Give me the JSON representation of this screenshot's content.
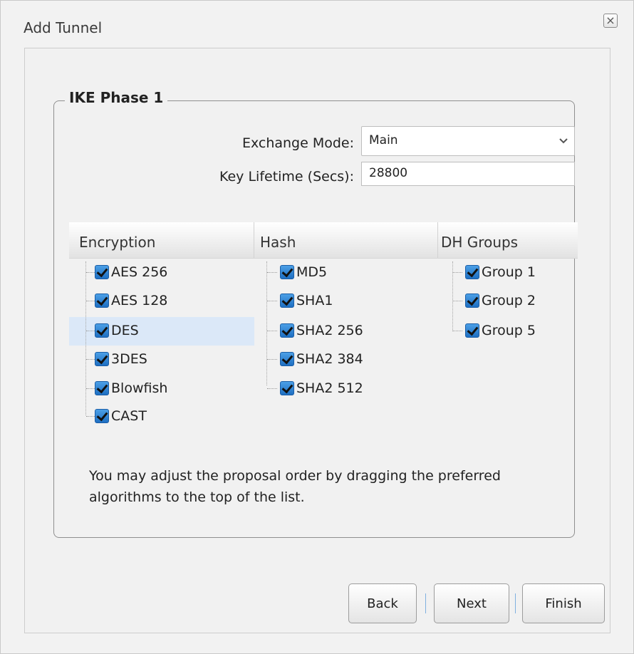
{
  "dialog": {
    "title": "Add Tunnel",
    "close_label": "×"
  },
  "section": {
    "legend": "IKE Phase 1"
  },
  "form": {
    "exchange_mode_label": "Exchange Mode:",
    "exchange_mode_value": "Main",
    "key_lifetime_label": "Key Lifetime (Secs):",
    "key_lifetime_value": "28800"
  },
  "columns": {
    "encryption": {
      "header": "Encryption",
      "items": [
        {
          "label": "AES 256",
          "checked": true
        },
        {
          "label": "AES 128",
          "checked": true
        },
        {
          "label": "DES",
          "checked": true,
          "selected": true
        },
        {
          "label": "3DES",
          "checked": true
        },
        {
          "label": "Blowfish",
          "checked": true
        },
        {
          "label": "CAST",
          "checked": true
        }
      ]
    },
    "hash": {
      "header": "Hash",
      "items": [
        {
          "label": "MD5",
          "checked": true
        },
        {
          "label": "SHA1",
          "checked": true
        },
        {
          "label": "SHA2 256",
          "checked": true
        },
        {
          "label": "SHA2 384",
          "checked": true
        },
        {
          "label": "SHA2 512",
          "checked": true
        }
      ]
    },
    "dh_groups": {
      "header": "DH Groups",
      "items": [
        {
          "label": "Group 1",
          "checked": true
        },
        {
          "label": "Group 2",
          "checked": true
        },
        {
          "label": "Group 5",
          "checked": true
        }
      ]
    }
  },
  "note": "You may adjust the proposal order by dragging the preferred algorithms to the top of the list.",
  "buttons": {
    "back": "Back",
    "next": "Next",
    "finish": "Finish"
  },
  "colors": {
    "checkbox": "#2f86d6",
    "selected_row": "#dbe8f8",
    "separator": "#7fb0e0"
  }
}
